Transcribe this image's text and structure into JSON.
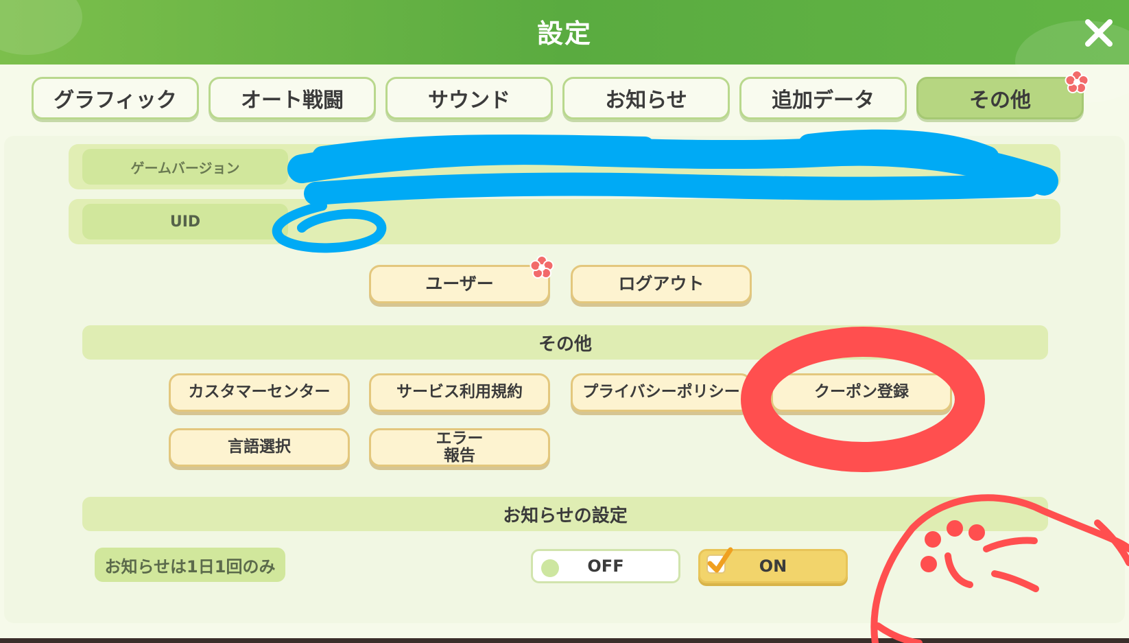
{
  "window": {
    "title": "設定",
    "close_icon": "close-x-icon"
  },
  "tabs": [
    {
      "label": "グラフィック",
      "active": false
    },
    {
      "label": "オート戦闘",
      "active": false
    },
    {
      "label": "サウンド",
      "active": false
    },
    {
      "label": "お知らせ",
      "active": false
    },
    {
      "label": "追加データ",
      "active": false
    },
    {
      "label": "その他",
      "active": true,
      "badge_icon": "flower-badge-icon"
    }
  ],
  "account": {
    "game_version_label": "ゲームバージョン",
    "game_version_value": "",
    "uid_label": "UID",
    "uid_value": "",
    "user_button": "ユーザー",
    "user_badge_icon": "flower-badge-icon",
    "logout_button": "ログアウト"
  },
  "other_section": {
    "header": "その他",
    "buttons": {
      "customer_center": "カスタマーセンター",
      "terms": "サービス利用規約",
      "privacy": "プライバシーポリシー",
      "coupon": "クーポン登録",
      "language": "言語選択",
      "error_report_line1": "エラー",
      "error_report_line2": "報告"
    }
  },
  "notification_section": {
    "header": "お知らせの設定",
    "label": "お知らせは1日1回のみ",
    "off_label": "OFF",
    "on_label": "ON",
    "selected": "ON"
  },
  "colors": {
    "title_bar": "#62b545",
    "tab_active": "#b6d681",
    "button_fill": "#fdf3d0",
    "redaction_blue": "#00aaf5",
    "annotation_red": "#ff4f4f"
  }
}
